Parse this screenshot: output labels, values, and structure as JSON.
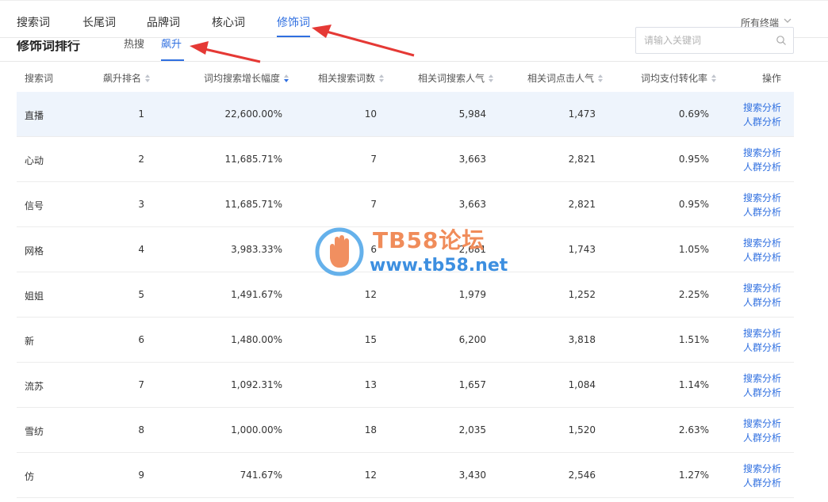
{
  "nav": {
    "tabs": [
      {
        "label": "搜索词"
      },
      {
        "label": "长尾词"
      },
      {
        "label": "品牌词"
      },
      {
        "label": "核心词"
      },
      {
        "label": "修饰词"
      }
    ],
    "active_tab": "修饰词",
    "device_filter": "所有终端"
  },
  "section": {
    "title": "修饰词排行",
    "subtabs": [
      {
        "label": "热搜"
      },
      {
        "label": "飙升"
      }
    ],
    "active_subtab": "飙升",
    "search_placeholder": "请输入关键词"
  },
  "table": {
    "columns": [
      "搜索词",
      "飙升排名",
      "词均搜索增长幅度",
      "相关搜索词数",
      "相关词搜索人气",
      "相关词点击人气",
      "词均支付转化率",
      "操作"
    ],
    "sorted_column": "词均搜索增长幅度",
    "sort_direction": "desc",
    "op_labels": [
      "搜索分析",
      "人群分析"
    ],
    "rows": [
      {
        "word": "直播",
        "rank": "1",
        "growth": "22,600.00%",
        "count": "10",
        "search": "5,984",
        "click": "1,473",
        "conv": "0.69%",
        "highlighted": true
      },
      {
        "word": "心动",
        "rank": "2",
        "growth": "11,685.71%",
        "count": "7",
        "search": "3,663",
        "click": "2,821",
        "conv": "0.95%"
      },
      {
        "word": "信号",
        "rank": "3",
        "growth": "11,685.71%",
        "count": "7",
        "search": "3,663",
        "click": "2,821",
        "conv": "0.95%"
      },
      {
        "word": "网格",
        "rank": "4",
        "growth": "3,983.33%",
        "count": "6",
        "search": "2,681",
        "click": "1,743",
        "conv": "1.05%"
      },
      {
        "word": "姐姐",
        "rank": "5",
        "growth": "1,491.67%",
        "count": "12",
        "search": "1,979",
        "click": "1,252",
        "conv": "2.25%"
      },
      {
        "word": "新",
        "rank": "6",
        "growth": "1,480.00%",
        "count": "15",
        "search": "6,200",
        "click": "3,818",
        "conv": "1.51%"
      },
      {
        "word": "流苏",
        "rank": "7",
        "growth": "1,092.31%",
        "count": "13",
        "search": "1,657",
        "click": "1,084",
        "conv": "1.14%"
      },
      {
        "word": "雪纺",
        "rank": "8",
        "growth": "1,000.00%",
        "count": "18",
        "search": "2,035",
        "click": "1,520",
        "conv": "2.63%"
      },
      {
        "word": "仿",
        "rank": "9",
        "growth": "741.67%",
        "count": "12",
        "search": "3,430",
        "click": "2,546",
        "conv": "1.27%"
      }
    ]
  },
  "watermark": {
    "title": "TB58论坛",
    "url": "www.tb58.net"
  },
  "colors": {
    "accent": "#2f6fe0",
    "row_highlight": "#eef4fc",
    "annotation_arrow": "#e53935"
  }
}
